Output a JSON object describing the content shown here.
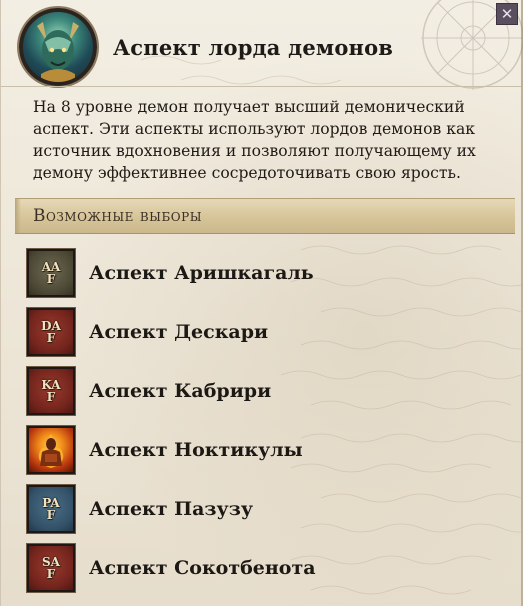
{
  "window": {
    "title": "Аспект лорда демонов",
    "close_symbol": "✕"
  },
  "description": "На 8 уровне демон получает высший демонический аспект. Эти аспекты используют лордов демонов как источник вдохновения и позволяют получающему их демону эффективнее сосредоточивать свою ярость.",
  "section": {
    "title": "Возможные выборы"
  },
  "options": [
    {
      "label": "Аспект Аришкагаль",
      "icon_text": "AA\nF",
      "icon_style": "olive"
    },
    {
      "label": "Аспект Дескари",
      "icon_text": "DA\nF",
      "icon_style": "red"
    },
    {
      "label": "Аспект Кабрири",
      "icon_text": "KA\nF",
      "icon_style": "red"
    },
    {
      "label": "Аспект Ноктикулы",
      "icon_text": "",
      "icon_style": "fire"
    },
    {
      "label": "Аспект Пазузу",
      "icon_text": "PA\nF",
      "icon_style": "blue"
    },
    {
      "label": "Аспект Сокотбенота",
      "icon_text": "SA\nF",
      "icon_style": "red"
    }
  ]
}
